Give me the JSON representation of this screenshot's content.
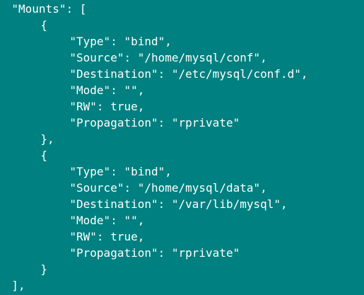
{
  "terminal": {
    "background_color": "#008080",
    "text_color": "#ffffff",
    "lines": [
      {
        "text": "\"Mounts\": [",
        "indent": 2
      },
      {
        "text": "{",
        "indent": 7
      },
      {
        "text": "\"Type\": \"bind\",",
        "indent": 12
      },
      {
        "text": "\"Source\": \"/home/mysql/conf\",",
        "indent": 12
      },
      {
        "text": "\"Destination\": \"/etc/mysql/conf.d\",",
        "indent": 12
      },
      {
        "text": "\"Mode\": \"\",",
        "indent": 12
      },
      {
        "text": "\"RW\": true,",
        "indent": 12
      },
      {
        "text": "\"Propagation\": \"rprivate\"",
        "indent": 12
      },
      {
        "text": "},",
        "indent": 7
      },
      {
        "text": "{",
        "indent": 7
      },
      {
        "text": "\"Type\": \"bind\",",
        "indent": 12
      },
      {
        "text": "\"Source\": \"/home/mysql/data\",",
        "indent": 12
      },
      {
        "text": "\"Destination\": \"/var/lib/mysql\",",
        "indent": 12
      },
      {
        "text": "\"Mode\": \"\",",
        "indent": 12
      },
      {
        "text": "\"RW\": true,",
        "indent": 12
      },
      {
        "text": "\"Propagation\": \"rprivate\"",
        "indent": 12
      },
      {
        "text": "}",
        "indent": 7
      },
      {
        "text": "],",
        "indent": 2
      }
    ]
  }
}
